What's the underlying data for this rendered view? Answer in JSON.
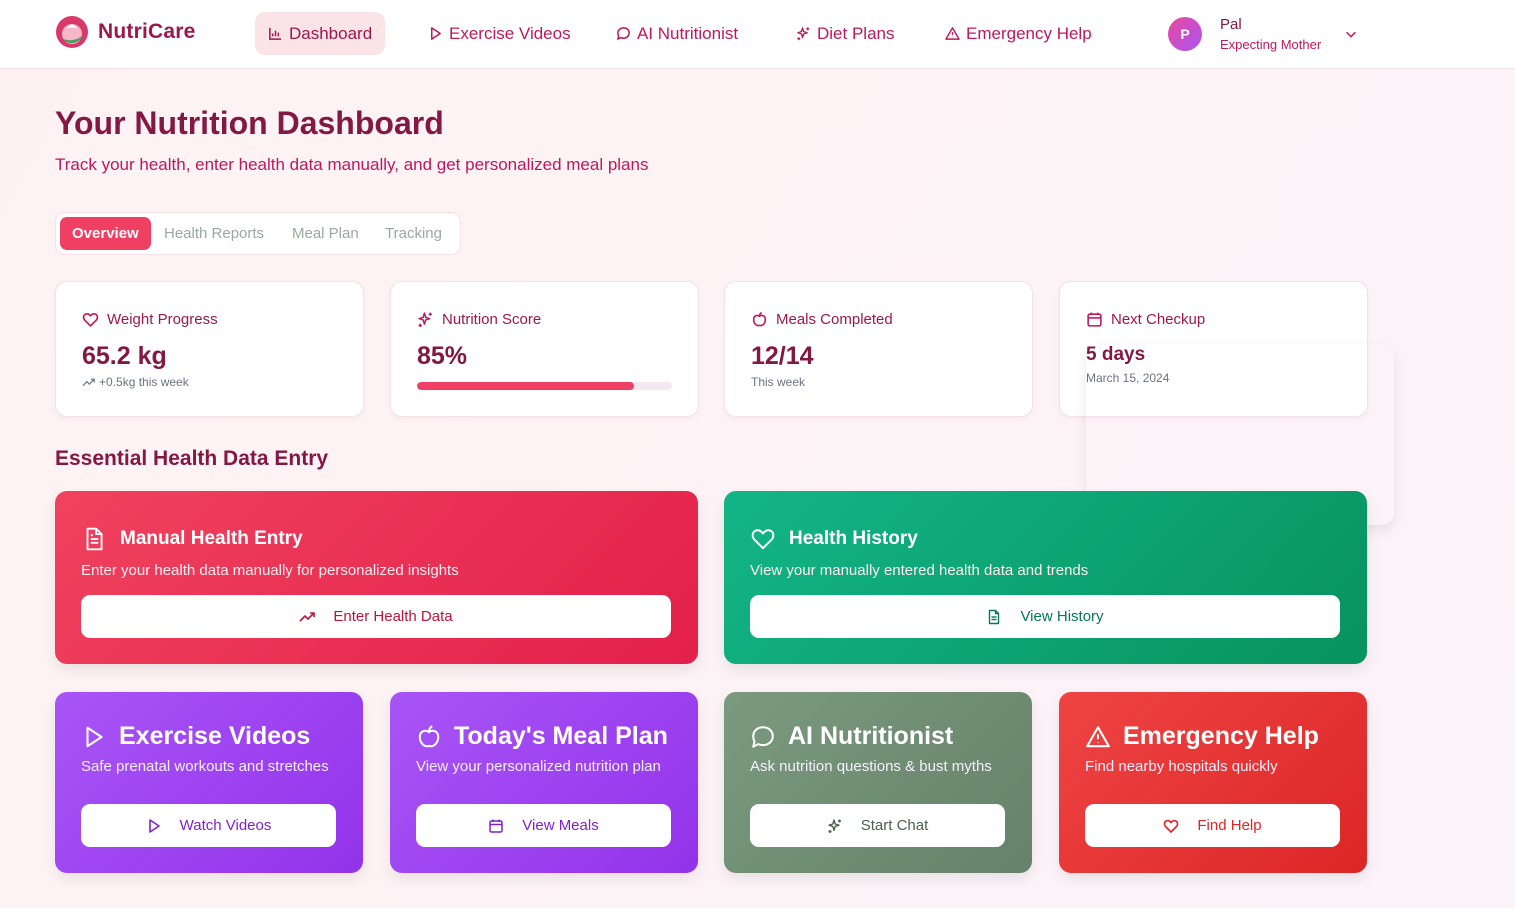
{
  "brand": {
    "name": "NutriCare"
  },
  "nav": {
    "items": [
      {
        "label": "Dashboard",
        "icon": "bar-chart-icon",
        "active": true
      },
      {
        "label": "Exercise Videos",
        "icon": "play-icon"
      },
      {
        "label": "AI Nutritionist",
        "icon": "chat-icon"
      },
      {
        "label": "Diet Plans",
        "icon": "sparkles-icon"
      },
      {
        "label": "Emergency Help",
        "icon": "alert-triangle-icon"
      }
    ]
  },
  "user": {
    "initial": "P",
    "name": "Pal",
    "role": "Expecting Mother"
  },
  "header": {
    "title": "Your Nutrition Dashboard",
    "subtitle": "Track your health, enter health data manually, and get personalized meal plans"
  },
  "tabs": [
    {
      "label": "Overview",
      "active": true
    },
    {
      "label": "Health Reports"
    },
    {
      "label": "Meal Plan"
    },
    {
      "label": "Tracking"
    }
  ],
  "stats": {
    "weight": {
      "label": "Weight Progress",
      "value": "65.2 kg",
      "note": "+0.5kg this week"
    },
    "nutrition": {
      "label": "Nutrition Score",
      "value": "85%",
      "progress": 0.85
    },
    "meals": {
      "label": "Meals Completed",
      "value": "12/14",
      "note": "This week"
    },
    "checkup": {
      "label": "Next Checkup",
      "value": "5 days",
      "note": "March 15, 2024"
    }
  },
  "section": {
    "title": "Essential Health Data Entry"
  },
  "cards": {
    "manual": {
      "title": "Manual Health Entry",
      "desc": "Enter your health data manually for personalized insights",
      "button": "Enter Health Data"
    },
    "history": {
      "title": "Health History",
      "desc": "View your manually entered health data and trends",
      "button": "View History"
    },
    "exercise": {
      "title": "Exercise Videos",
      "desc": "Safe prenatal workouts and stretches",
      "button": "Watch Videos"
    },
    "meal": {
      "title": "Today's Meal Plan",
      "desc": "View your personalized nutrition plan",
      "button": "View Meals"
    },
    "ai": {
      "title": "AI Nutritionist",
      "desc": "Ask nutrition questions & bust myths",
      "button": "Start Chat"
    },
    "emergency": {
      "title": "Emergency Help",
      "desc": "Find nearby hospitals quickly",
      "button": "Find Help"
    }
  },
  "colors": {
    "accent": "#ef3f62",
    "brand": "#9d174d",
    "green": "#10a976",
    "purple": "#9f45f4",
    "sage": "#728f76",
    "red": "#e53935"
  }
}
